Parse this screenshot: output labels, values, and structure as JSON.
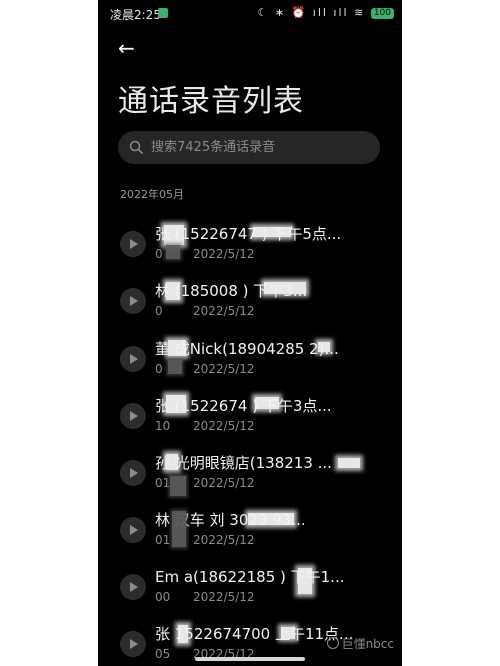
{
  "status_bar": {
    "time": "凌晨2:25",
    "icons": "☾ ∗ ⏰ ıll ıll ≋",
    "battery": "100"
  },
  "page": {
    "title": "通话录音列表"
  },
  "search": {
    "placeholder": "搜索7425条通话录音"
  },
  "section": {
    "date": "2022年05月"
  },
  "recordings": [
    {
      "title": "张 (15226747 ) 下午5点...",
      "duration": "0",
      "date": "2022/5/12"
    },
    {
      "title": "林 (185008 ) 下午3...",
      "duration": "0",
      "date": "2022/5/12"
    },
    {
      "title": "董 成Nick(18904285 2)...",
      "duration": "0",
      "date": "2022/5/12"
    },
    {
      "title": "张 (1522674 ) 下午3点...",
      "duration": "10",
      "date": "2022/5/12"
    },
    {
      "title": "孙 光明眼镜店(138213 ...",
      "duration": "01",
      "date": "2022/5/12"
    },
    {
      "title": "林 汉车 刘 3023 93...",
      "duration": "01",
      "date": "2022/5/12"
    },
    {
      "title": "Em a(18622185 ) 下午1...",
      "duration": "00",
      "date": "2022/5/12"
    },
    {
      "title": "张 1522674700 上午11点...",
      "duration": "05",
      "date": "2022/5/12"
    }
  ],
  "watermark": {
    "text": "巨懂nbcc"
  },
  "colors": {
    "background": "#000000",
    "search_bg": "#262626",
    "text_primary": "#f2f2f2",
    "text_secondary": "#8a8a8a",
    "accent_green": "#3ab06b"
  }
}
